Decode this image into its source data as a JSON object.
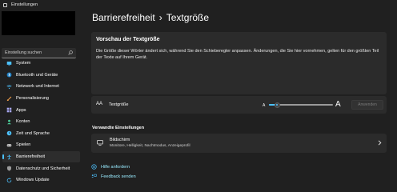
{
  "window": {
    "title": "Einstellungen"
  },
  "search": {
    "placeholder": "Einstellung suchen"
  },
  "sidebar": {
    "items": [
      {
        "label": "System",
        "icon": "monitor-icon",
        "color": "#4cc2ff"
      },
      {
        "label": "Bluetooth und Geräte",
        "icon": "bluetooth-icon",
        "color": "#4cc2ff"
      },
      {
        "label": "Netzwerk und Internet",
        "icon": "wifi-icon",
        "color": "#4cc2ff"
      },
      {
        "label": "Personalisierung",
        "icon": "brush-icon",
        "color": "#f7a24b"
      },
      {
        "label": "Apps",
        "icon": "apps-icon",
        "color": "#a9a9f5"
      },
      {
        "label": "Konten",
        "icon": "person-icon",
        "color": "#4cd29b"
      },
      {
        "label": "Zeit und Sprache",
        "icon": "globe-clock-icon",
        "color": "#4cc2ff"
      },
      {
        "label": "Spielen",
        "icon": "gamepad-icon",
        "color": "#cfcfcf"
      },
      {
        "label": "Barrierefreiheit",
        "icon": "accessibility-icon",
        "color": "#4cc2ff",
        "active": true
      },
      {
        "label": "Datenschutz und Sicherheit",
        "icon": "shield-icon",
        "color": "#9a9a9a"
      },
      {
        "label": "Windows Update",
        "icon": "update-icon",
        "color": "#4cc2ff"
      }
    ]
  },
  "header": {
    "breadcrumb_parent": "Barrierefreiheit",
    "separator": "›",
    "title": "Textgröße"
  },
  "preview": {
    "heading": "Vorschau der Textgröße",
    "text": "Die Größe dieser Wörter ändert sich, während Sie den Schieberegler anpassen. Änderungen, die Sie hier vornehmen, gelten für den größten Teil der Texte auf Ihrem Gerät."
  },
  "text_size": {
    "icon_glyph": "AA",
    "label": "Textgröße",
    "small_a": "A",
    "large_a": "A",
    "slider_value_fraction": 0.13,
    "apply_label": "Anwenden"
  },
  "related": {
    "heading": "Verwandte Einstellungen",
    "display_title": "Bildschirm",
    "display_subtitle": "Monitore, Helligkeit, Nachtmodus, Anzeigeprofil"
  },
  "links": {
    "help": "Hilfe anfordern",
    "feedback": "Feedback senden"
  },
  "colors": {
    "accent": "#4cc2ff",
    "link": "#99ebff",
    "background": "#202020",
    "card": "#2b2b2b"
  }
}
